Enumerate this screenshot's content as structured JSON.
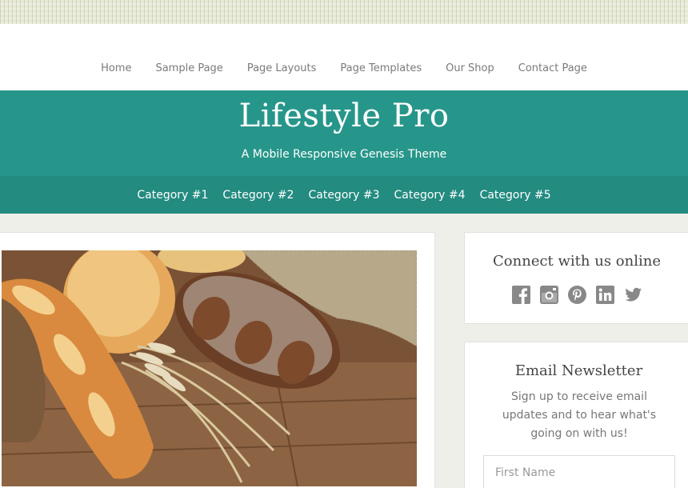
{
  "top_nav": {
    "items": [
      "Home",
      "Sample Page",
      "Page Layouts",
      "Page Templates",
      "Our Shop",
      "Contact Page"
    ]
  },
  "header": {
    "title": "Lifestyle Pro",
    "description": "A Mobile Responsive Genesis Theme"
  },
  "category_nav": {
    "items": [
      "Category #1",
      "Category #2",
      "Category #3",
      "Category #4",
      "Category #5"
    ]
  },
  "social_widget": {
    "title": "Connect with us online",
    "icons": [
      "facebook-icon",
      "instagram-icon",
      "pinterest-icon",
      "linkedin-icon",
      "twitter-icon"
    ]
  },
  "newsletter_widget": {
    "title": "Email Newsletter",
    "text": "Sign up to receive email updates and to hear what's going on with us!",
    "first_name_placeholder": "First Name"
  },
  "colors": {
    "header_teal": "#27968a",
    "category_teal": "#238b80",
    "icon_gray": "#888888"
  }
}
